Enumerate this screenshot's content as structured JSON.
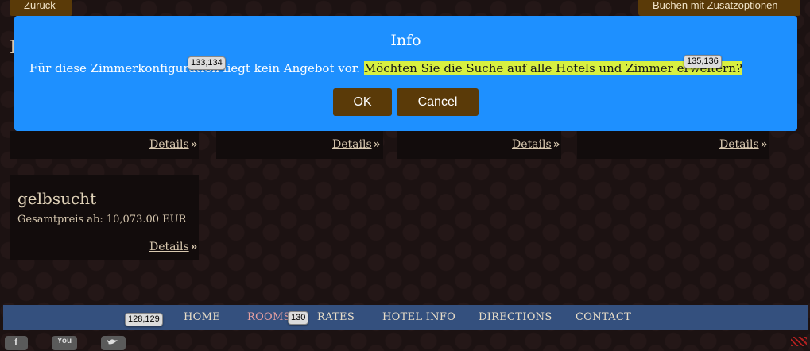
{
  "top": {
    "back_label": "Zurück",
    "book_extras_label": "Buchen mit Zusatzoptionen"
  },
  "page": {
    "title_partial": "I"
  },
  "cards": {
    "details_label": "Details",
    "details_chevron": "»"
  },
  "hotel": {
    "name": "gelbsucht",
    "price": "Gesamtpreis ab: 10,073.00 EUR"
  },
  "modal": {
    "title": "Info",
    "message_plain": "Für diese Zimmerkonfiguration liegt kein Angebot vor. ",
    "message_highlight": "Möchten Sie die Suche auf alle Hotels und Zimmer erweitern?",
    "ok_label": "OK",
    "cancel_label": "Cancel",
    "color": "#1e90ff",
    "highlight_color": "#d8f040"
  },
  "badges": {
    "ok_cancel": "133,134",
    "highlight": "135,136",
    "home": "128,129",
    "rooms": "130"
  },
  "nav": {
    "items": [
      "HOME",
      "ROOMS",
      "RATES",
      "HOTEL INFO",
      "DIRECTIONS",
      "CONTACT"
    ],
    "active": "ROOMS",
    "bar_color": "#34507e"
  },
  "social": {
    "facebook_icon": "facebook-icon",
    "youtube_label": "You",
    "twitter_icon": "twitter-icon"
  },
  "colors": {
    "button_brown": "#5a3a08",
    "background": "#1c1212"
  }
}
